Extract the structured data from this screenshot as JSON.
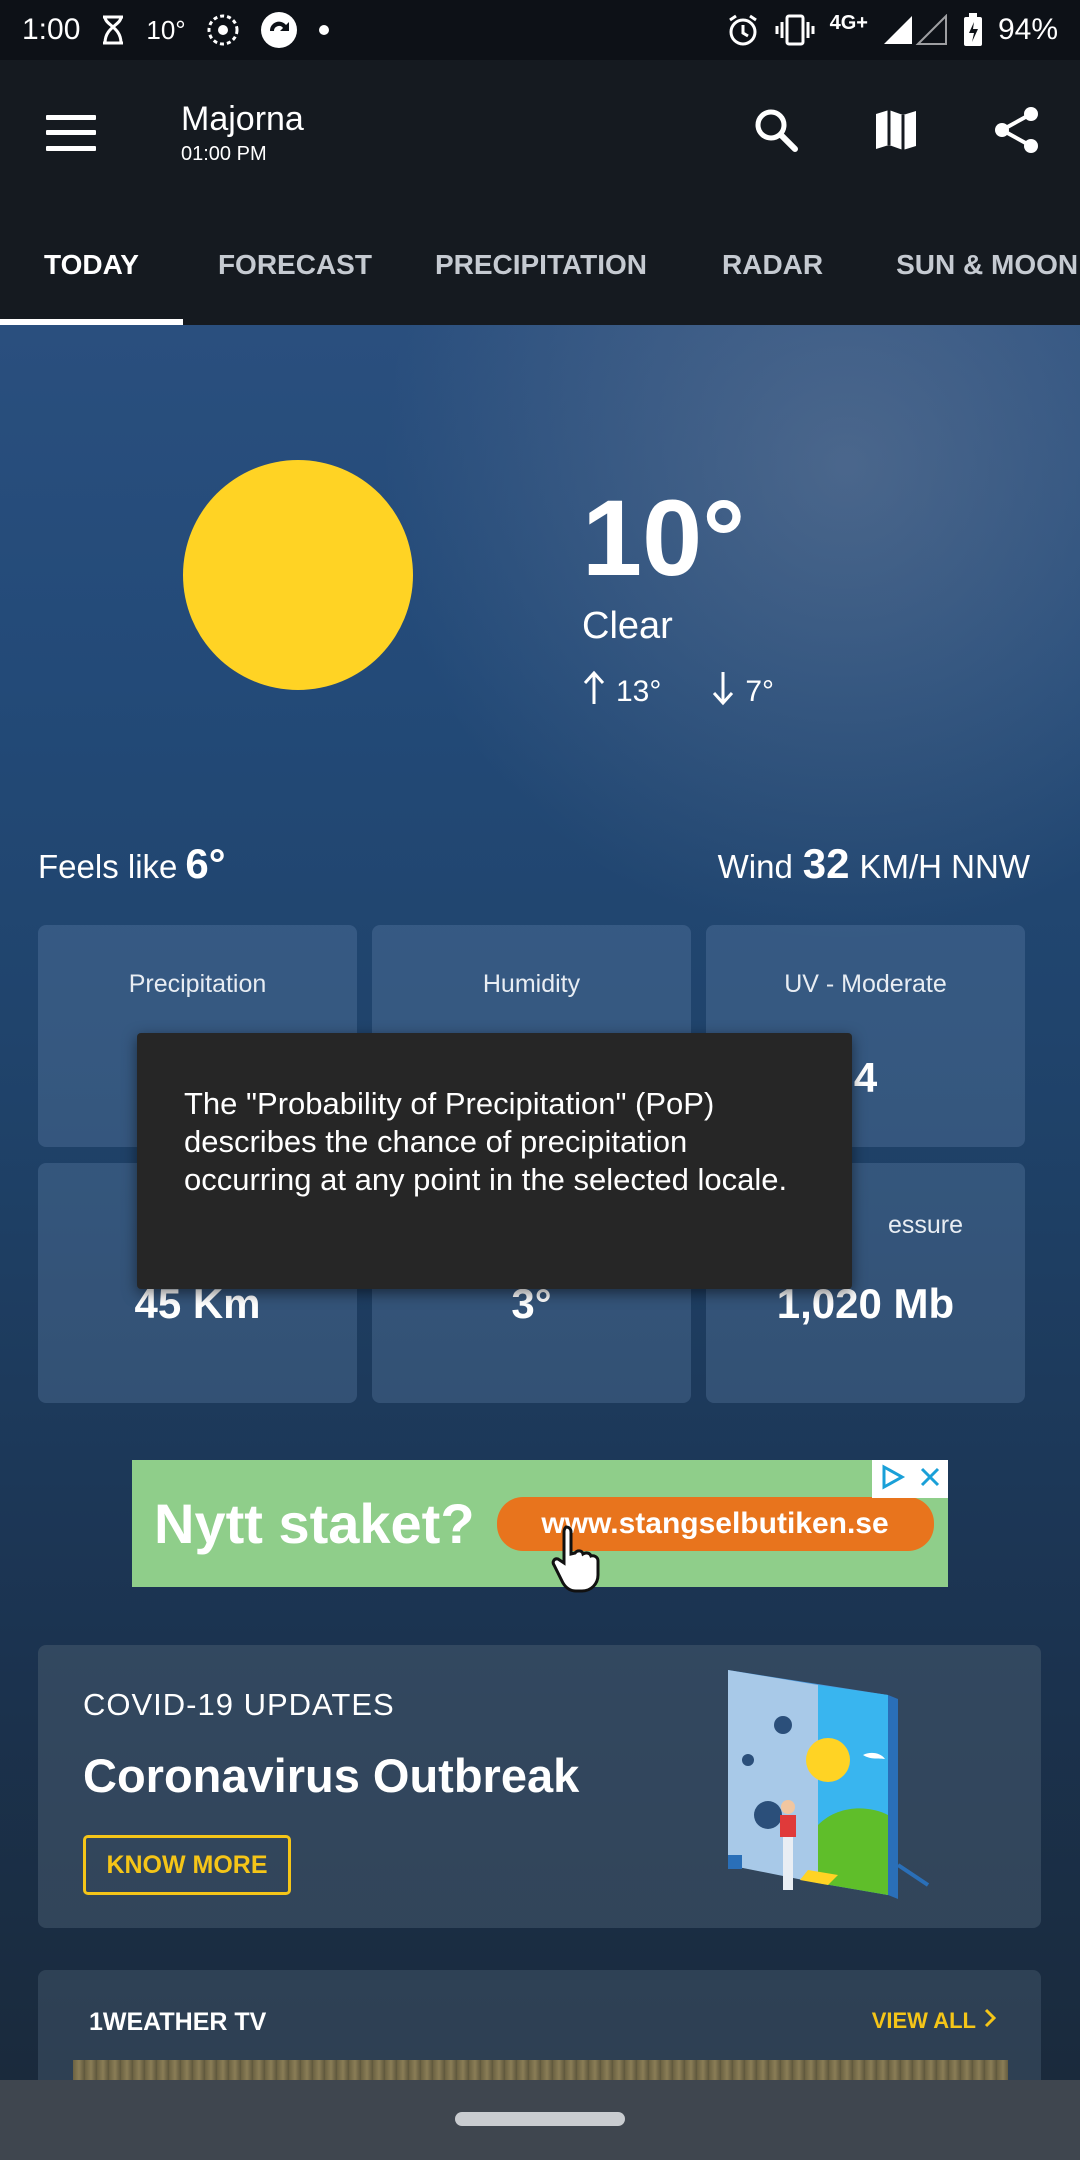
{
  "status_bar": {
    "time": "1:00",
    "temp_indicator": "10°",
    "network": "4G+",
    "battery": "94%"
  },
  "app_bar": {
    "location": "Majorna",
    "time": "01:00 PM"
  },
  "tabs": [
    {
      "label": "TODAY",
      "active": true
    },
    {
      "label": "FORECAST",
      "active": false
    },
    {
      "label": "PRECIPITATION",
      "active": false
    },
    {
      "label": "RADAR",
      "active": false
    },
    {
      "label": "SUN & MOON",
      "active": false
    }
  ],
  "current": {
    "temperature": "10°",
    "condition": "Clear",
    "high": "13°",
    "low": "7°",
    "feels_like_label": "Feels like",
    "feels_like_value": "6°",
    "wind_label": "Wind",
    "wind_speed": "32",
    "wind_unit_dir": "KM/H NNW"
  },
  "tiles": [
    {
      "label": "Precipitation",
      "value": ""
    },
    {
      "label": "Humidity",
      "value": ""
    },
    {
      "label": "UV - Moderate",
      "value": "4"
    },
    {
      "label": "",
      "value": "45 Km"
    },
    {
      "label": "",
      "value": "3°"
    },
    {
      "label": "essure",
      "value": "1,020 Mb"
    }
  ],
  "tooltip": {
    "text": "The \"Probability of Precipitation\" (PoP) describes the chance of precipitation occurring at any point in the selected locale."
  },
  "ad": {
    "headline": "Nytt staket?",
    "url": "www.stangselbutiken.se"
  },
  "covid_card": {
    "kicker": "COVID-19 UPDATES",
    "title": "Coronavirus Outbreak",
    "button": "KNOW MORE"
  },
  "tv_card": {
    "title": "1WEATHER TV",
    "view_all": "VIEW ALL"
  },
  "colors": {
    "sun": "#ffd324",
    "accent": "#f5c518",
    "ad_bg": "#8fce8a",
    "ad_pill": "#e8741d"
  },
  "icons": [
    "hourglass-icon",
    "aperture-icon",
    "sync-icon",
    "alarm-icon",
    "vibrate-icon",
    "signal-icon",
    "battery-icon",
    "menu-icon",
    "search-icon",
    "map-icon",
    "share-icon",
    "arrow-up-icon",
    "arrow-down-icon",
    "adchoices-icon",
    "close-icon",
    "chevron-right-icon"
  ]
}
